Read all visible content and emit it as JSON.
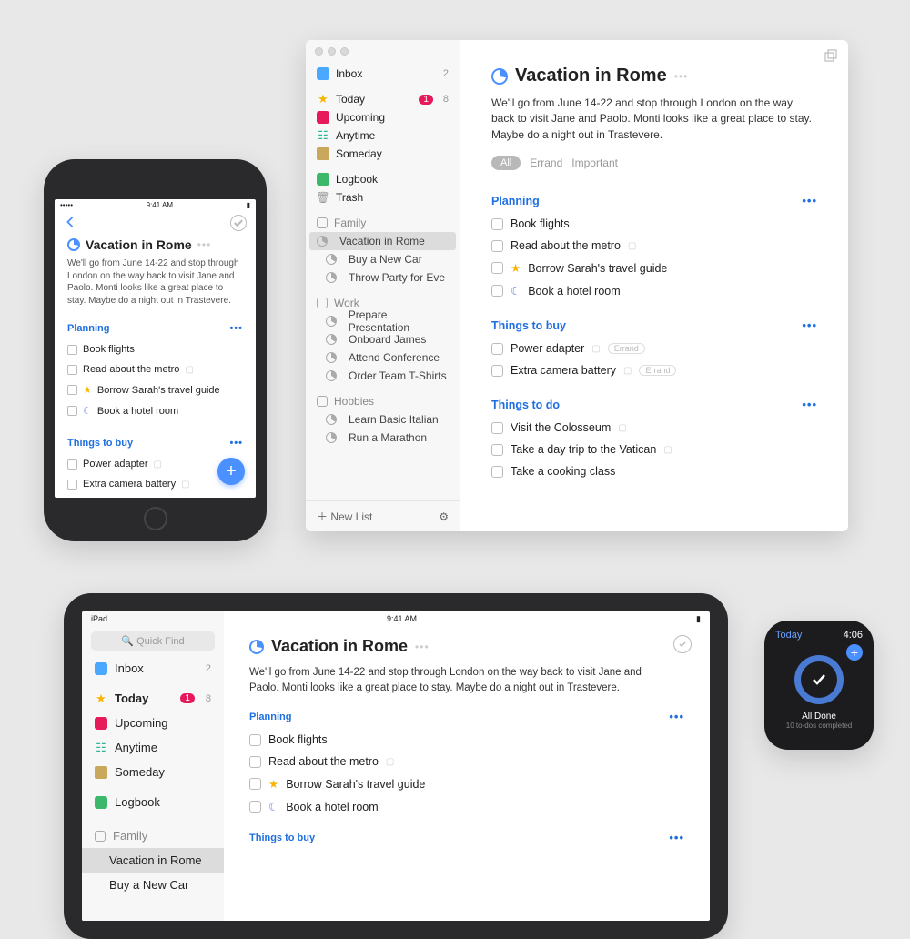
{
  "project": {
    "title": "Vacation in Rome",
    "description": "We'll go from June 14-22 and stop through London on the way back to visit Jane and Paolo. Monti looks like a great place to stay. Maybe do a night out in Trastevere.",
    "tags": {
      "all": "All",
      "errand": "Errand",
      "important": "Important"
    },
    "sections": {
      "planning": {
        "name": "Planning",
        "tasks": {
          "t1": "Book flights",
          "t2": "Read about the metro",
          "t3": "Borrow Sarah's travel guide",
          "t4": "Book a hotel room"
        }
      },
      "buy": {
        "name": "Things to buy",
        "tasks": {
          "t1": "Power adapter",
          "t2": "Extra camera battery"
        },
        "tag": "Errand"
      },
      "do": {
        "name": "Things to do",
        "tasks": {
          "t1": "Visit the Colosseum",
          "t2": "Take a day trip to the Vatican",
          "t3": "Take a cooking class"
        }
      }
    }
  },
  "sidebar": {
    "inbox": "Inbox",
    "inbox_count": "2",
    "today": "Today",
    "today_badge": "1",
    "today_count": "8",
    "upcoming": "Upcoming",
    "anytime": "Anytime",
    "someday": "Someday",
    "logbook": "Logbook",
    "trash": "Trash",
    "areas": {
      "family": {
        "name": "Family",
        "projects": {
          "p1": "Vacation in Rome",
          "p2": "Buy a New Car",
          "p3": "Throw Party for Eve"
        }
      },
      "work": {
        "name": "Work",
        "projects": {
          "p1": "Prepare Presentation",
          "p2": "Onboard James",
          "p3": "Attend Conference",
          "p4": "Order Team T-Shirts"
        }
      },
      "hobbies": {
        "name": "Hobbies",
        "projects": {
          "p1": "Learn Basic Italian",
          "p2": "Run a Marathon"
        }
      }
    },
    "new_list": "New List"
  },
  "ipad": {
    "search_placeholder": "Quick Find",
    "status_left": "iPad",
    "status_time": "9:41 AM"
  },
  "iphone": {
    "status_time": "9:41 AM"
  },
  "watch": {
    "header": "Today",
    "time": "4:06",
    "title": "All Done",
    "subtitle": "10 to-dos completed"
  }
}
